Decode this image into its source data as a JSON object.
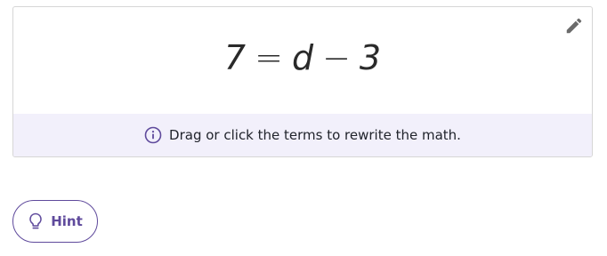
{
  "equation": {
    "terms": [
      "7",
      "=",
      "d",
      "−",
      "3"
    ]
  },
  "info": {
    "message": "Drag or click the terms to rewrite the math.",
    "icon": "info-icon"
  },
  "toolbar": {
    "edit_icon": "pencil-icon"
  },
  "hint": {
    "label": "Hint",
    "icon": "lightbulb-icon"
  },
  "colors": {
    "accent": "#5f4a9c",
    "info_bg": "#f2f0fb",
    "text": "#21242c"
  }
}
